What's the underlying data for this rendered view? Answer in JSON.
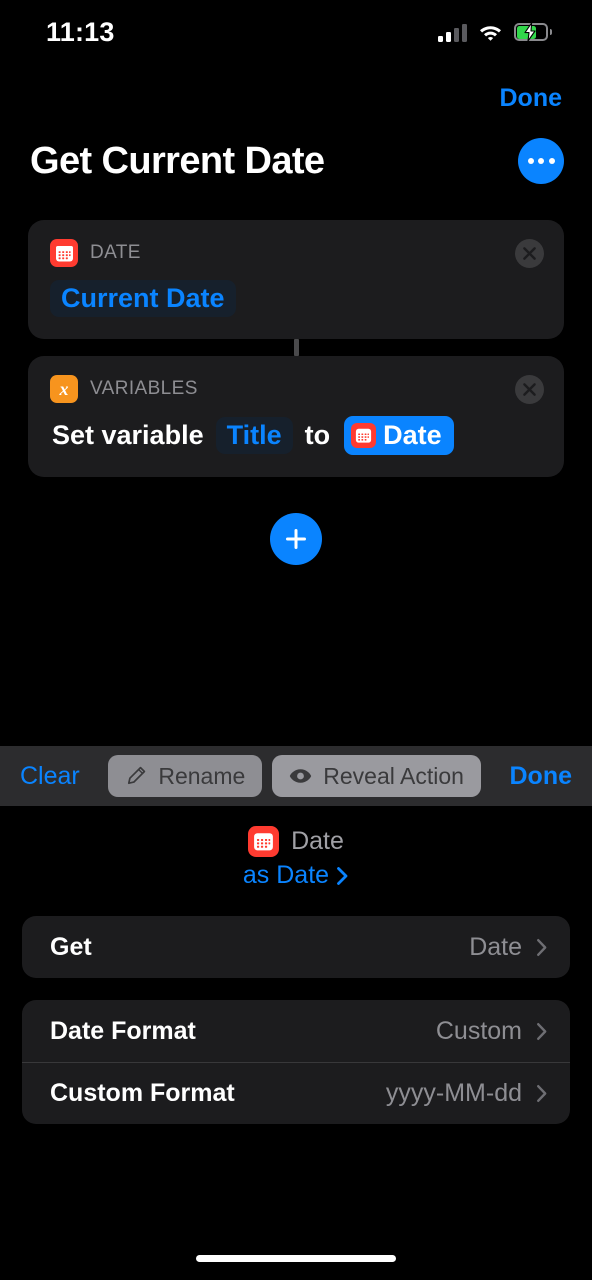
{
  "status_bar": {
    "time": "11:13",
    "signal_icon": "cellular-signal-icon",
    "signal_bars_filled": 2,
    "signal_bars_total": 4,
    "wifi_icon": "wifi-icon",
    "battery_icon": "battery-charging-icon",
    "battery_charging": true
  },
  "nav": {
    "done_label": "Done"
  },
  "header": {
    "title": "Get Current Date",
    "more_icon": "ellipsis-icon"
  },
  "actions": [
    {
      "category": "DATE",
      "icon": "calendar-icon",
      "icon_color": "#ff3b30",
      "close_icon": "close-circle-icon",
      "body": [
        {
          "kind": "token",
          "text": "Current Date",
          "style": "plain"
        }
      ]
    },
    {
      "category": "VARIABLES",
      "icon": "variable-x-icon",
      "icon_color": "#f7941e",
      "icon_glyph": "x",
      "close_icon": "close-circle-icon",
      "body": [
        {
          "kind": "text",
          "text": "Set variable"
        },
        {
          "kind": "token",
          "text": "Title",
          "style": "plain"
        },
        {
          "kind": "text",
          "text": "to"
        },
        {
          "kind": "token",
          "text": "Date",
          "style": "selected",
          "token_icon": "calendar-icon"
        }
      ]
    }
  ],
  "add_action": {
    "icon": "plus-icon",
    "color": "#0a84ff"
  },
  "toolbar": {
    "clear_label": "Clear",
    "rename_label": "Rename",
    "rename_icon": "pencil-icon",
    "reveal_label": "Reveal Action",
    "reveal_icon": "eye-icon",
    "done_label": "Done"
  },
  "detail": {
    "icon": "calendar-icon",
    "name": "Date",
    "subtitle": "as Date",
    "subtitle_chevron": "chevron-right-icon",
    "groups": [
      {
        "rows": [
          {
            "label": "Get",
            "value": "Date",
            "chevron": "chevron-right-icon"
          }
        ]
      },
      {
        "rows": [
          {
            "label": "Date Format",
            "value": "Custom",
            "chevron": "chevron-right-icon"
          },
          {
            "label": "Custom Format",
            "value": "yyyy-MM-dd",
            "chevron": "chevron-right-icon"
          }
        ]
      }
    ]
  },
  "home_indicator": "home-indicator",
  "colors": {
    "accent": "#0a84ff",
    "date_app": "#ff3b30",
    "variables_app": "#f7941e",
    "battery_green": "#32d74b",
    "card_bg": "#1c1c1e",
    "toolbar_bg": "#2c2c2e"
  }
}
